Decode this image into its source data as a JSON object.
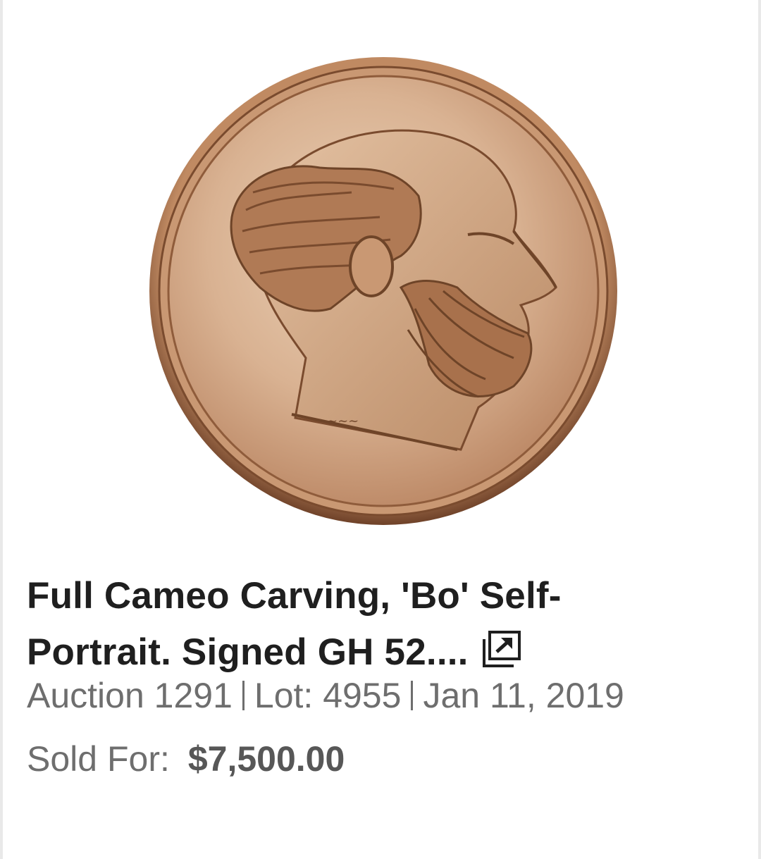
{
  "lot": {
    "image_icon": "coin-photo",
    "title": "Full Cameo Carving, 'Bo' Self-Portrait. Signed GH 52....",
    "external_link_icon": "open-in-new-window-icon",
    "auction": "Auction 1291",
    "lot_number": "Lot: 4955",
    "date": "Jan 11, 2019",
    "sold_label": "Sold For:",
    "sold_price": "$7,500.00"
  },
  "colors": {
    "title": "#1f1f1f",
    "meta": "#6e6e6e",
    "coin_rim": "#8a5836",
    "coin_face": "#d9b292",
    "background": "#ffffff"
  }
}
